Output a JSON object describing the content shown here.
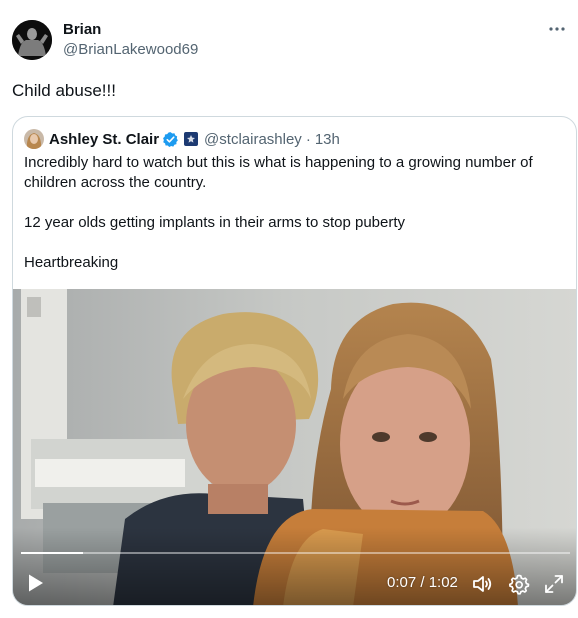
{
  "author": {
    "display_name": "Brian",
    "handle": "@BrianLakewood69"
  },
  "tweet": {
    "text": "Child abuse!!!"
  },
  "quoted": {
    "display_name": "Ashley St. Clair",
    "handle": "@stclairashley",
    "separator": "·",
    "time": "13h",
    "paragraphs": [
      "Incredibly hard to watch but this is what is happening to a growing number of children across the country.",
      "12 year olds getting implants in their arms to stop puberty",
      "Heartbreaking"
    ],
    "verified_icon": "verified-badge-icon",
    "affiliate_icon": "affiliate-badge-icon"
  },
  "video": {
    "time_display": "0:07 / 1:02",
    "progress": 0.113,
    "icons": [
      "play-icon",
      "volume-icon",
      "settings-icon",
      "fullscreen-icon"
    ]
  },
  "colors": {
    "text": "#0f1419",
    "secondary": "#536471",
    "border": "#cfd9de",
    "verified": "#1d9bf0"
  }
}
